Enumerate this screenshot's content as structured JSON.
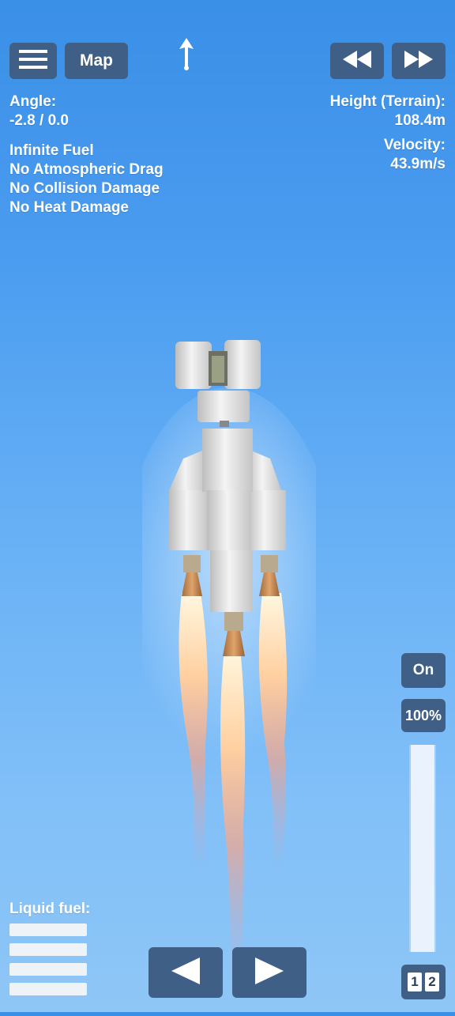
{
  "topbar": {
    "menu_icon": "hamburger-icon",
    "map_label": "Map",
    "direction_icon": "arrow-up-icon",
    "rewind_icon": "rewind-icon",
    "fastforward_icon": "fast-forward-icon"
  },
  "telemetry": {
    "angle_label": "Angle:",
    "angle_value": "-2.8 / 0.0",
    "height_label": "Height (Terrain):",
    "height_value": "108.4m",
    "velocity_label": "Velocity:",
    "velocity_value": "43.9m/s"
  },
  "cheats": [
    "Infinite Fuel",
    "No Atmospheric Drag",
    "No Collision Damage",
    "No Heat Damage"
  ],
  "engine": {
    "toggle_label": "On",
    "throttle_label": "100%",
    "throttle_level": 1.0
  },
  "fuel": {
    "label": "Liquid fuel:",
    "bars": 4
  },
  "controls": {
    "left_icon": "arrow-left-icon",
    "right_icon": "arrow-right-icon",
    "stage_1": "1",
    "stage_2": "2"
  },
  "colors": {
    "button": "#3f5f86",
    "sky_top": "#3a8fe6",
    "sky_bottom": "#8ec6f6"
  }
}
